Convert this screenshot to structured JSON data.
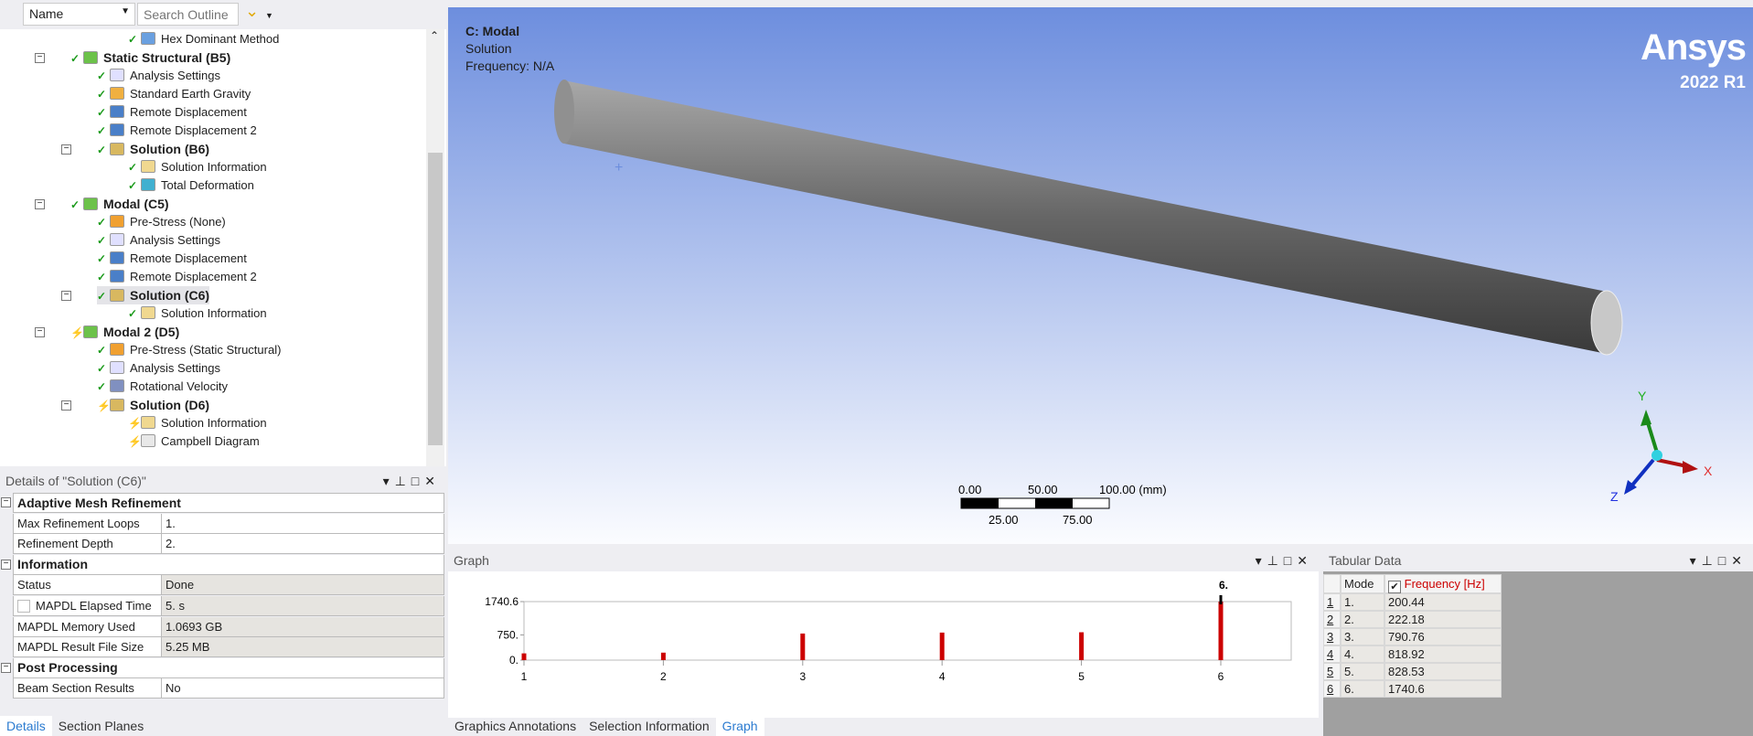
{
  "outline": {
    "name_select": "Name",
    "search_placeholder": "Search Outline",
    "items": [
      {
        "label": "Hex Dominant Method",
        "level": 3,
        "status": "ok",
        "icon": "mesh-method-icon",
        "color": "#6aa0e0"
      },
      {
        "label": "Static Structural (B5)",
        "level": 1,
        "status": "ok",
        "bold": true,
        "icon": "static-structural-icon",
        "color": "#6cc24a",
        "exp": true
      },
      {
        "label": "Analysis Settings",
        "level": 2,
        "status": "ok",
        "icon": "analysis-settings-icon",
        "color": "#e0e0ff"
      },
      {
        "label": "Standard Earth Gravity",
        "level": 2,
        "status": "ok",
        "icon": "gravity-icon",
        "color": "#f0b040"
      },
      {
        "label": "Remote Displacement",
        "level": 2,
        "status": "ok",
        "icon": "remote-displacement-icon",
        "color": "#4a7fc8"
      },
      {
        "label": "Remote Displacement 2",
        "level": 2,
        "status": "ok",
        "icon": "remote-displacement-icon",
        "color": "#4a7fc8"
      },
      {
        "label": "Solution (B6)",
        "level": 2,
        "status": "ok",
        "bold": true,
        "icon": "solution-icon",
        "color": "#d8b860",
        "exp": true
      },
      {
        "label": "Solution Information",
        "level": 3,
        "status": "ok",
        "icon": "solution-information-icon",
        "color": "#f0d890"
      },
      {
        "label": "Total Deformation",
        "level": 3,
        "status": "ok",
        "icon": "total-deformation-icon",
        "color": "#40b0d0"
      },
      {
        "label": "Modal (C5)",
        "level": 1,
        "status": "ok",
        "bold": true,
        "icon": "modal-icon",
        "color": "#6cc24a",
        "exp": true
      },
      {
        "label": "Pre-Stress (None)",
        "level": 2,
        "status": "ok",
        "icon": "pre-stress-icon",
        "color": "#f0a030"
      },
      {
        "label": "Analysis Settings",
        "level": 2,
        "status": "ok",
        "icon": "analysis-settings-icon",
        "color": "#e0e0ff"
      },
      {
        "label": "Remote Displacement",
        "level": 2,
        "status": "ok",
        "icon": "remote-displacement-icon",
        "color": "#4a7fc8"
      },
      {
        "label": "Remote Displacement 2",
        "level": 2,
        "status": "ok",
        "icon": "remote-displacement-icon",
        "color": "#4a7fc8"
      },
      {
        "label": "Solution (C6)",
        "level": 2,
        "status": "ok",
        "bold": true,
        "selected": true,
        "icon": "solution-icon",
        "color": "#d8b860",
        "exp": true
      },
      {
        "label": "Solution Information",
        "level": 3,
        "status": "ok",
        "icon": "solution-information-icon",
        "color": "#f0d890"
      },
      {
        "label": "Modal 2 (D5)",
        "level": 1,
        "status": "pending",
        "bold": true,
        "icon": "modal-icon",
        "color": "#6cc24a",
        "exp": true
      },
      {
        "label": "Pre-Stress (Static Structural)",
        "level": 2,
        "status": "ok",
        "icon": "pre-stress-icon",
        "color": "#f0a030"
      },
      {
        "label": "Analysis Settings",
        "level": 2,
        "status": "ok",
        "icon": "analysis-settings-icon",
        "color": "#e0e0ff"
      },
      {
        "label": "Rotational Velocity",
        "level": 2,
        "status": "ok",
        "icon": "rotational-velocity-icon",
        "color": "#8090c0"
      },
      {
        "label": "Solution (D6)",
        "level": 2,
        "status": "pending",
        "bold": true,
        "icon": "solution-icon",
        "color": "#d8b860",
        "exp": true
      },
      {
        "label": "Solution Information",
        "level": 3,
        "status": "pending",
        "icon": "solution-information-icon",
        "color": "#f0d890"
      },
      {
        "label": "Campbell Diagram",
        "level": 3,
        "status": "pending",
        "icon": "campbell-diagram-icon",
        "color": "#e8e8e8"
      }
    ]
  },
  "details": {
    "title": "Details of \"Solution (C6)\"",
    "rows": [
      {
        "group": "Adaptive Mesh Refinement"
      },
      {
        "k": "Max Refinement Loops",
        "v": "1."
      },
      {
        "k": "Refinement Depth",
        "v": "2."
      },
      {
        "group": "Information"
      },
      {
        "k": "Status",
        "v": "Done",
        "ro": true
      },
      {
        "k": "MAPDL Elapsed Time",
        "v": "5. s",
        "ro": true,
        "checkbox": true
      },
      {
        "k": "MAPDL Memory Used",
        "v": "1.0693 GB",
        "ro": true
      },
      {
        "k": "MAPDL Result File Size",
        "v": "5.25 MB",
        "ro": true
      },
      {
        "group": "Post Processing"
      },
      {
        "k": "Beam Section Results",
        "v": "No"
      }
    ],
    "tabs": [
      "Details",
      "Section Planes"
    ]
  },
  "viewport": {
    "analysis": "C: Modal",
    "object": "Solution",
    "frequency": "Frequency: N/A",
    "brand": "Ansys",
    "version": "2022 R1",
    "scale": {
      "top": [
        "0.00",
        "50.00",
        "100.00 (mm)"
      ],
      "bottom": [
        "25.00",
        "75.00"
      ]
    },
    "axes": {
      "x": "X",
      "y": "Y",
      "z": "Z"
    }
  },
  "graph": {
    "title": "Graph",
    "tabs": [
      "Graphics Annotations",
      "Selection Information",
      "Graph"
    ],
    "active_tab": "Graph"
  },
  "chart_data": {
    "type": "bar",
    "categories": [
      "1",
      "2",
      "3",
      "4",
      "5",
      "6"
    ],
    "values": [
      200.44,
      222.18,
      790.76,
      818.92,
      828.53,
      1740.6
    ],
    "yticks": [
      "0.",
      "750.",
      "1740.6"
    ],
    "ylim": [
      0,
      1740.6
    ],
    "selected_label": "6.",
    "bar_color": "#cc0000"
  },
  "tabular": {
    "title": "Tabular Data",
    "columns": [
      "Mode",
      "Frequency [Hz]"
    ],
    "header_color": "#cc0000",
    "rows": [
      [
        "1",
        "1.",
        "200.44"
      ],
      [
        "2",
        "2.",
        "222.18"
      ],
      [
        "3",
        "3.",
        "790.76"
      ],
      [
        "4",
        "4.",
        "818.92"
      ],
      [
        "5",
        "5.",
        "828.53"
      ],
      [
        "6",
        "6.",
        "1740.6"
      ]
    ]
  }
}
